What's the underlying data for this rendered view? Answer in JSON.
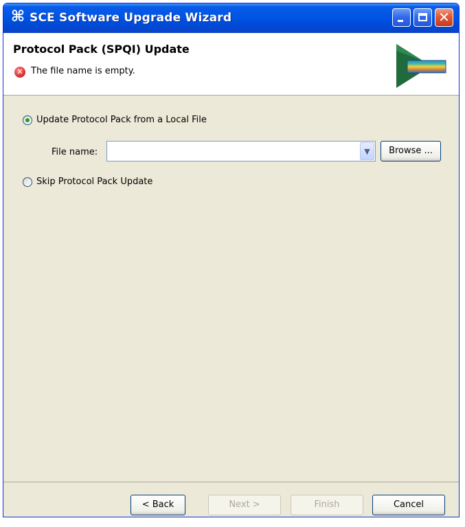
{
  "window": {
    "title": "SCE Software Upgrade Wizard",
    "title_icon": "⌘"
  },
  "banner": {
    "title": "Protocol Pack (SPQI) Update",
    "error_message": "The file name is empty."
  },
  "options": {
    "local_file_label": "Update Protocol Pack from a Local File",
    "local_file_selected": true,
    "skip_label": "Skip Protocol Pack Update",
    "skip_selected": false
  },
  "file": {
    "label": "File name:",
    "value": "",
    "browse_label": "Browse ..."
  },
  "footer": {
    "back_label": "< Back",
    "next_label": "Next >",
    "finish_label": "Finish",
    "cancel_label": "Cancel"
  }
}
